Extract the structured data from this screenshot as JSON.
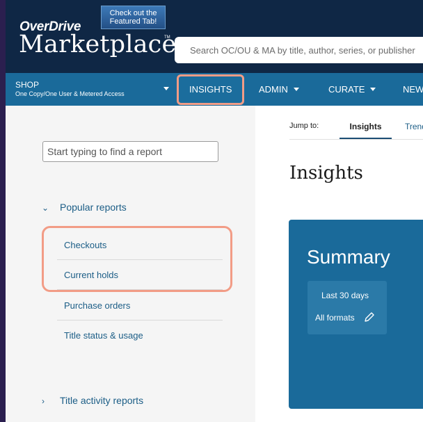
{
  "header": {
    "promo_text": "Check out the Featured Tab!",
    "brand_small": "OverDrive",
    "brand_big": "Marketplace",
    "trademark": "TM",
    "search_placeholder": "Search OC/OU & MA by title, author, series, or publisher"
  },
  "nav": {
    "shop_label": "SHOP",
    "shop_sub": "One Copy/One User & Metered Access",
    "items": [
      {
        "label": "INSIGHTS"
      },
      {
        "label": "ADMIN"
      },
      {
        "label": "CURATE"
      },
      {
        "label": "NEW"
      }
    ]
  },
  "sidebar": {
    "search_placeholder": "Start typing to find a report",
    "popular_heading": "Popular reports",
    "popular_reports": [
      "Checkouts",
      "Current holds",
      "Purchase orders",
      "Title status & usage"
    ],
    "title_activity_heading": "Title activity reports"
  },
  "main": {
    "jump_label": "Jump to:",
    "jump_tabs": [
      "Insights",
      "Trends"
    ],
    "page_title": "Insights",
    "summary_title": "Summary",
    "filter_range": "Last 30 days",
    "filter_formats": "All formats"
  },
  "colors": {
    "header_bg": "#0f2745",
    "nav_bg": "#1a6a9a",
    "highlight": "#f29c86",
    "link": "#1b5d86"
  }
}
